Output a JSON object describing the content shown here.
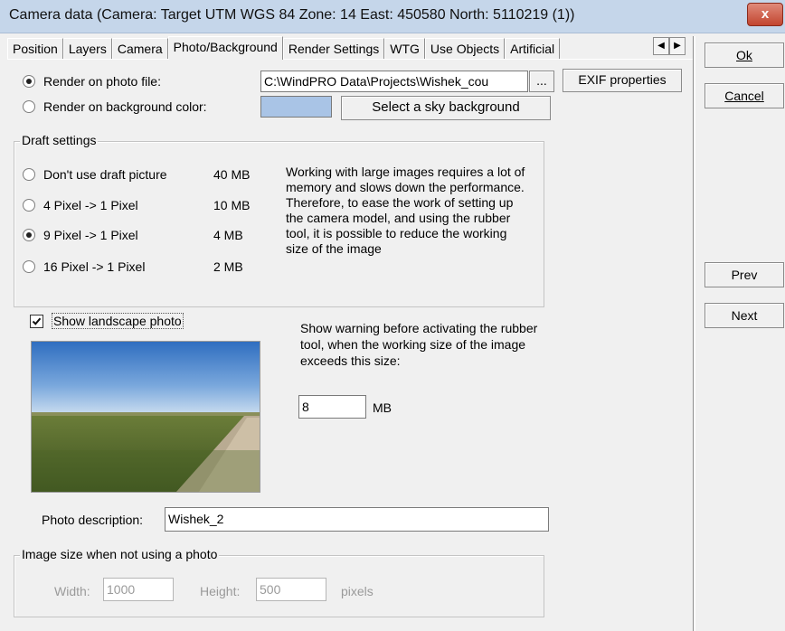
{
  "window": {
    "title": "Camera data   (Camera:  Target UTM WGS 84 Zone: 14  East: 450580  North: 5110219 (1))",
    "close_glyph": "x"
  },
  "tabs": [
    {
      "label": "Position"
    },
    {
      "label": "Layers"
    },
    {
      "label": "Camera"
    },
    {
      "label": "Photo/Background"
    },
    {
      "label": "Render Settings"
    },
    {
      "label": "WTG"
    },
    {
      "label": "Use Objects"
    },
    {
      "label": "Artificial"
    }
  ],
  "active_tab": "Photo/Background",
  "render": {
    "photo_label": "Render on photo file:",
    "bg_label": "Render on background color:",
    "file_path": "C:\\WindPRO Data\\Projects\\Wishek_cou",
    "browse_label": "...",
    "exif_label": "EXIF properties",
    "sky_label": "Select a sky background",
    "bg_color": "#a9c4e6",
    "selected": "photo"
  },
  "draft": {
    "legend": "Draft settings",
    "options": [
      {
        "label": "Don't use draft picture",
        "size": "40 MB",
        "selected": false
      },
      {
        "label": "4 Pixel -> 1 Pixel",
        "size": "10 MB",
        "selected": false
      },
      {
        "label": "9 Pixel -> 1 Pixel",
        "size": "4 MB",
        "selected": true
      },
      {
        "label": "16 Pixel -> 1 Pixel",
        "size": "2 MB",
        "selected": false
      }
    ],
    "info": "Working with large images requires a lot of memory and slows down the performance. Therefore, to ease the work of setting up the camera model, and using the rubber tool, it is possible to reduce the working size of the image"
  },
  "landscape": {
    "label": "Show landscape photo",
    "checked": true
  },
  "warning": {
    "text": "Show warning before activating the rubber tool, when the working size of the image exceeds this size:",
    "value": "8",
    "unit": "MB"
  },
  "photo_description": {
    "label": "Photo description:",
    "value": "Wishek_2"
  },
  "image_size": {
    "legend": "Image size when not using a photo",
    "width_label": "Width:",
    "width_value": "1000",
    "height_label": "Height:",
    "height_value": "500",
    "unit": "pixels"
  },
  "side_buttons": {
    "ok": "Ok",
    "cancel": "Cancel",
    "prev": "Prev",
    "next": "Next"
  }
}
